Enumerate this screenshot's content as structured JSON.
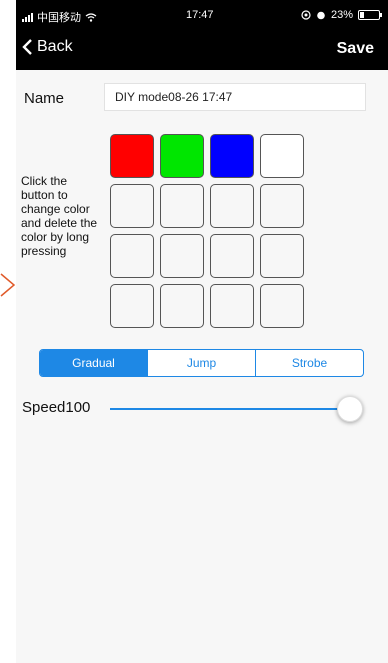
{
  "status_bar": {
    "carrier": "中国移动",
    "time": "17:47",
    "battery": "23%"
  },
  "nav": {
    "back_label": "Back",
    "save_label": "Save"
  },
  "form": {
    "name_label": "Name",
    "name_value": "DIY mode08-26 17:47"
  },
  "hint": "Click the button to change color and delete the color by long pressing",
  "color_grid": {
    "rows": 4,
    "cols": 4,
    "colors": [
      "#ff0000",
      "#00e600",
      "#0000ff",
      "#ffffff",
      "",
      "",
      "",
      "",
      "",
      "",
      "",
      "",
      "",
      "",
      "",
      ""
    ]
  },
  "modes": {
    "tabs": [
      "Gradual",
      "Jump",
      "Strobe"
    ],
    "active_index": 0,
    "accent": "#1e88e5"
  },
  "speed": {
    "label": "Speed100",
    "value": 100,
    "max": 100
  }
}
